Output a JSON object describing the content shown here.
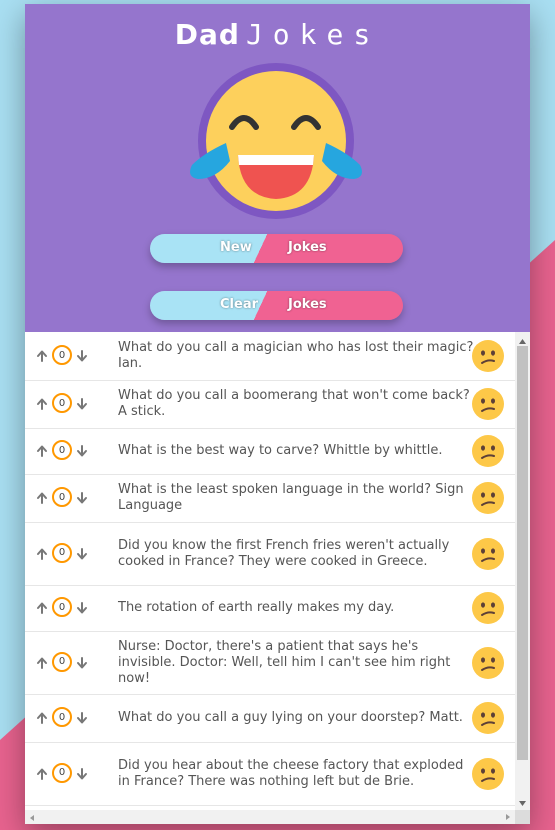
{
  "app": {
    "title_bold": "Dad",
    "title_light": "Jokes"
  },
  "buttons": {
    "new_word1": "New",
    "new_word2": "Jokes",
    "clear_word1": "Clear",
    "clear_word2": "Jokes"
  },
  "jokes": [
    {
      "score": "0",
      "text": "What do you call a magician who has lost their magic? Ian."
    },
    {
      "score": "0",
      "text": "What do you call a boomerang that won't come back? A stick."
    },
    {
      "score": "0",
      "text": "What is the best way to carve? Whittle by whittle."
    },
    {
      "score": "0",
      "text": "What is the least spoken language in the world? Sign Language"
    },
    {
      "score": "0",
      "text": "Did you know the first French fries weren't actually cooked in France? They were cooked in Greece."
    },
    {
      "score": "0",
      "text": "The rotation of earth really makes my day."
    },
    {
      "score": "0",
      "text": "Nurse: Doctor, there's a patient that says he's invisible. Doctor: Well, tell him I can't see him right now!"
    },
    {
      "score": "0",
      "text": "What do you call a guy lying on your doorstep? Matt."
    },
    {
      "score": "0",
      "text": "Did you hear about the cheese factory that exploded in France? There was nothing left but de Brie."
    }
  ],
  "colors": {
    "header": "#9575cd",
    "accent_pink": "#f06292",
    "accent_blue": "#a9e3f5",
    "score_ring": "#ff9800"
  },
  "icons": {
    "upvote": "arrow-up-icon",
    "downvote": "arrow-down-icon",
    "reaction": "confused-face-icon",
    "logo": "laughing-tears-emoji"
  }
}
